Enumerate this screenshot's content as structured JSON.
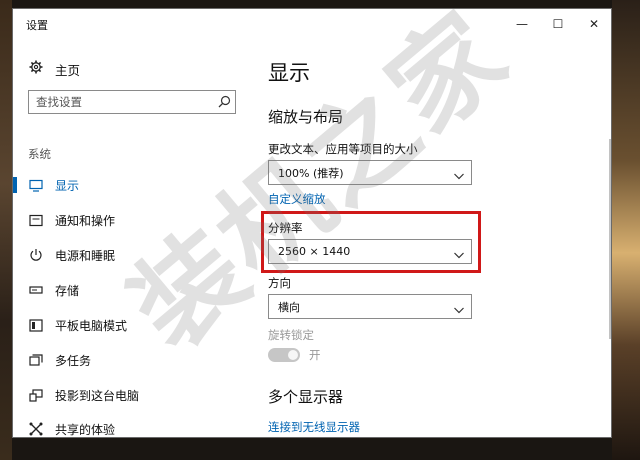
{
  "window": {
    "title": "设置",
    "controls": {
      "minimize": "—",
      "maximize": "☐",
      "close": "✕"
    }
  },
  "sidebar": {
    "home_label": "主页",
    "search_placeholder": "查找设置",
    "section_label": "系统",
    "items": [
      {
        "label": "显示",
        "icon": "monitor-icon",
        "active": true
      },
      {
        "label": "通知和操作",
        "icon": "notification-icon",
        "active": false
      },
      {
        "label": "电源和睡眠",
        "icon": "power-icon",
        "active": false
      },
      {
        "label": "存储",
        "icon": "storage-icon",
        "active": false
      },
      {
        "label": "平板电脑模式",
        "icon": "tablet-mode-icon",
        "active": false
      },
      {
        "label": "多任务",
        "icon": "multitask-icon",
        "active": false
      },
      {
        "label": "投影到这台电脑",
        "icon": "project-icon",
        "active": false
      },
      {
        "label": "共享的体验",
        "icon": "shared-experience-icon",
        "active": false
      }
    ]
  },
  "main": {
    "page_title": "显示",
    "scale_layout": {
      "heading": "缩放与布局",
      "text_size_label": "更改文本、应用等项目的大小",
      "text_size_value": "100% (推荐)",
      "custom_scaling_link": "自定义缩放",
      "resolution_label": "分辨率",
      "resolution_value": "2560 × 1440",
      "orientation_label": "方向",
      "orientation_value": "横向",
      "rotation_lock_label": "旋转锁定",
      "rotation_lock_state": "开"
    },
    "multi_display": {
      "heading": "多个显示器",
      "wireless_link": "连接到无线显示器"
    }
  },
  "watermark": {
    "text": "装机之家",
    "logo_text": "装机之家"
  },
  "colors": {
    "accent": "#0063b1",
    "highlight_border": "#d01818"
  }
}
